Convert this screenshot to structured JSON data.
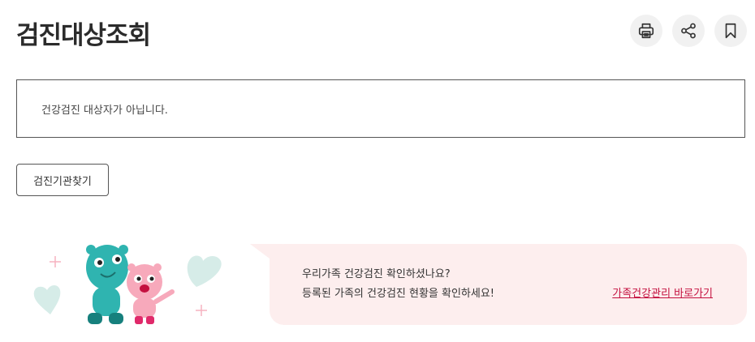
{
  "page": {
    "title": "검진대상조회"
  },
  "toolbar": {
    "print_icon": "printer-icon",
    "share_icon": "share-icon",
    "bookmark_icon": "bookmark-icon"
  },
  "notice": {
    "message": "건강검진 대상자가 아닙니다."
  },
  "actions": {
    "find_institution_label": "검진기관찾기"
  },
  "banner": {
    "line1": "우리가족 건강검진 확인하셨나요?",
    "line2": "등록된 가족의 건강검진 현황을 확인하세요!",
    "link_label": "가족건강관리 바로가기",
    "bubble_color": "#fdeeee",
    "link_color": "#c4103f"
  }
}
